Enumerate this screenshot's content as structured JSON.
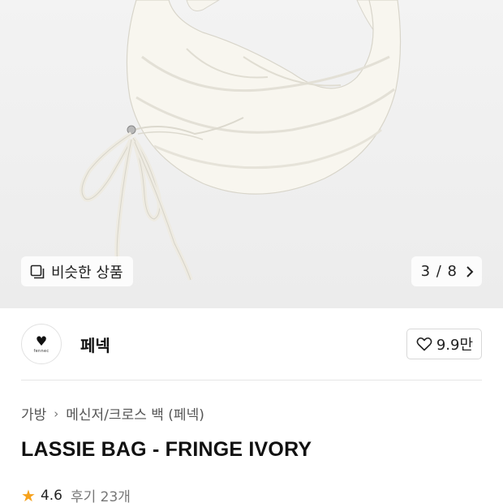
{
  "hero": {
    "similar_label": "비슷한 상품",
    "similar_icon": "similar-items-icon",
    "counter": "3 / 8",
    "counter_icon": "chevron-right-icon"
  },
  "brand": {
    "name": "페넥",
    "logo_text": "fennec",
    "like_count": "9.9만",
    "like_icon": "heart-outline-icon"
  },
  "breadcrumb": {
    "level1": "가방",
    "level2": "메신저/크로스 백 (페넥)"
  },
  "product": {
    "title": "LASSIE BAG - FRINGE IVORY"
  },
  "rating": {
    "score": "4.6",
    "reviews": "후기 23개",
    "star_color": "#f6a21d"
  }
}
